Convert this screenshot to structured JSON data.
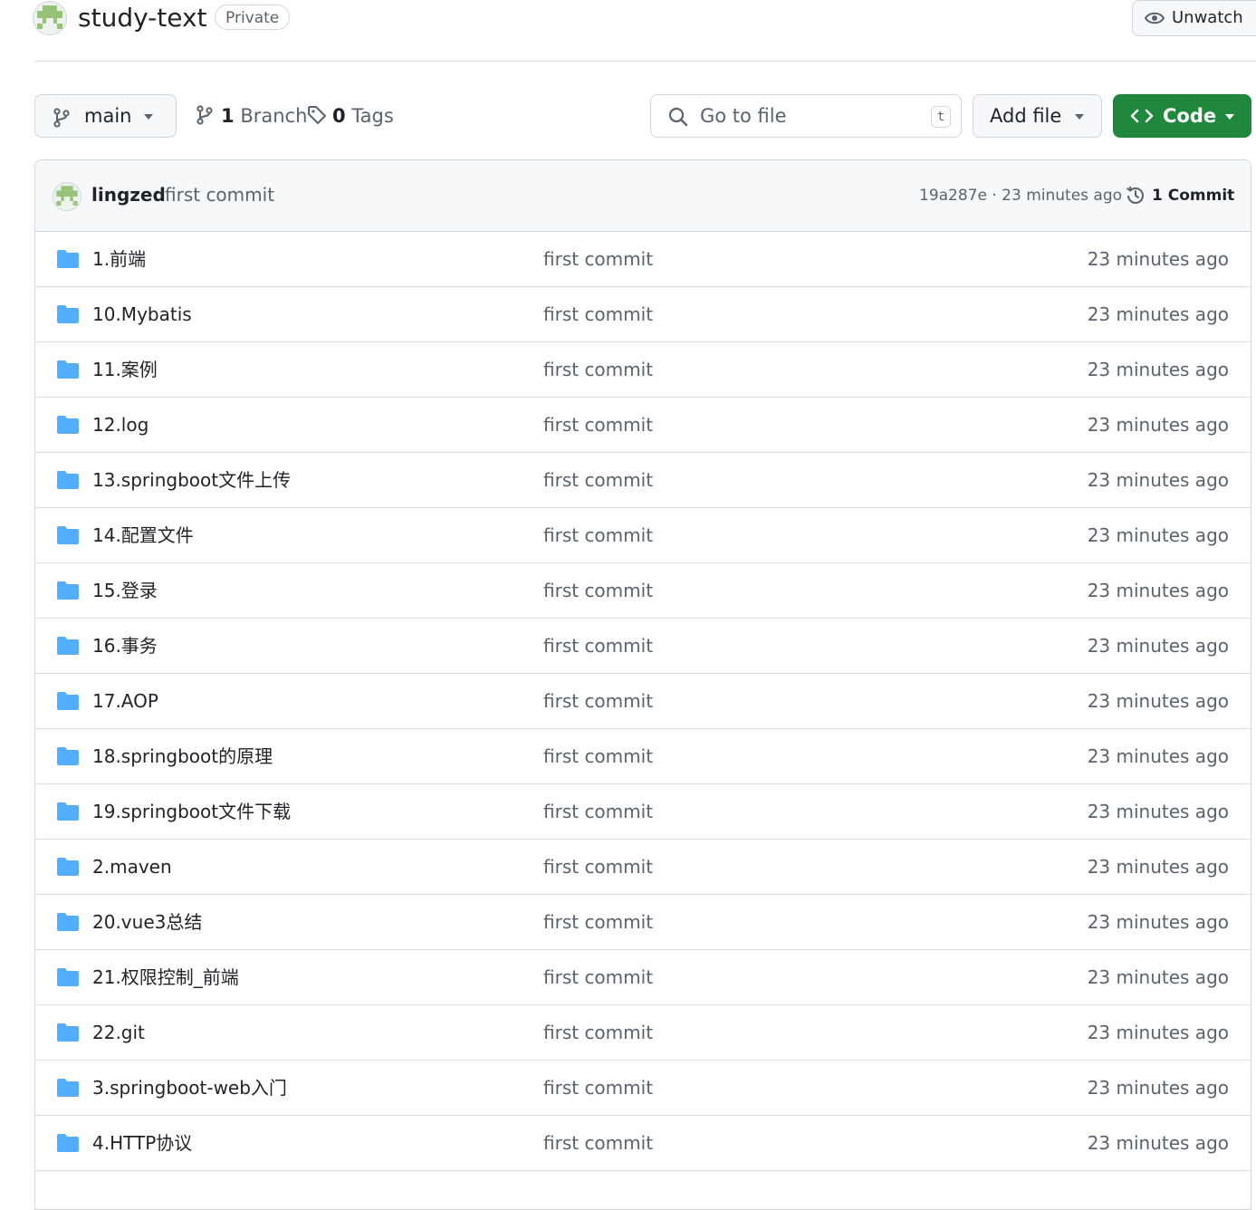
{
  "repo": {
    "name": "study-text",
    "visibility": "Private",
    "watch_label": "Unwatch"
  },
  "toolbar": {
    "branch": "main",
    "branches_count": "1",
    "branches_label": "Branch",
    "tags_count": "0",
    "tags_label": "Tags",
    "search_placeholder": "Go to file",
    "search_shortcut": "t",
    "add_file_label": "Add file",
    "code_label": "Code"
  },
  "latest_commit": {
    "author": "lingzed",
    "message": "first commit",
    "meta": "19a287e · 23 minutes ago",
    "history_label": "1 Commit"
  },
  "files": [
    {
      "name": "1.前端",
      "message": "first commit",
      "time": "23 minutes ago"
    },
    {
      "name": "10.Mybatis",
      "message": "first commit",
      "time": "23 minutes ago"
    },
    {
      "name": "11.案例",
      "message": "first commit",
      "time": "23 minutes ago"
    },
    {
      "name": "12.log",
      "message": "first commit",
      "time": "23 minutes ago"
    },
    {
      "name": "13.springboot文件上传",
      "message": "first commit",
      "time": "23 minutes ago"
    },
    {
      "name": "14.配置文件",
      "message": "first commit",
      "time": "23 minutes ago"
    },
    {
      "name": "15.登录",
      "message": "first commit",
      "time": "23 minutes ago"
    },
    {
      "name": "16.事务",
      "message": "first commit",
      "time": "23 minutes ago"
    },
    {
      "name": "17.AOP",
      "message": "first commit",
      "time": "23 minutes ago"
    },
    {
      "name": "18.springboot的原理",
      "message": "first commit",
      "time": "23 minutes ago"
    },
    {
      "name": "19.springboot文件下载",
      "message": "first commit",
      "time": "23 minutes ago"
    },
    {
      "name": "2.maven",
      "message": "first commit",
      "time": "23 minutes ago"
    },
    {
      "name": "20.vue3总结",
      "message": "first commit",
      "time": "23 minutes ago"
    },
    {
      "name": "21.权限控制_前端",
      "message": "first commit",
      "time": "23 minutes ago"
    },
    {
      "name": "22.git",
      "message": "first commit",
      "time": "23 minutes ago"
    },
    {
      "name": "3.springboot-web入门",
      "message": "first commit",
      "time": "23 minutes ago"
    },
    {
      "name": "4.HTTP协议",
      "message": "first commit",
      "time": "23 minutes ago"
    }
  ],
  "colors": {
    "accent_green": "#1f883d",
    "folder_blue": "#54aeff",
    "muted_text": "#59636e",
    "avatar_green": "#97c279"
  },
  "icons": {
    "branch": "git-branch-icon",
    "tag": "tag-icon",
    "search": "search-icon",
    "code": "code-icon",
    "history": "history-icon",
    "folder": "folder-icon",
    "watch": "eye-icon"
  }
}
